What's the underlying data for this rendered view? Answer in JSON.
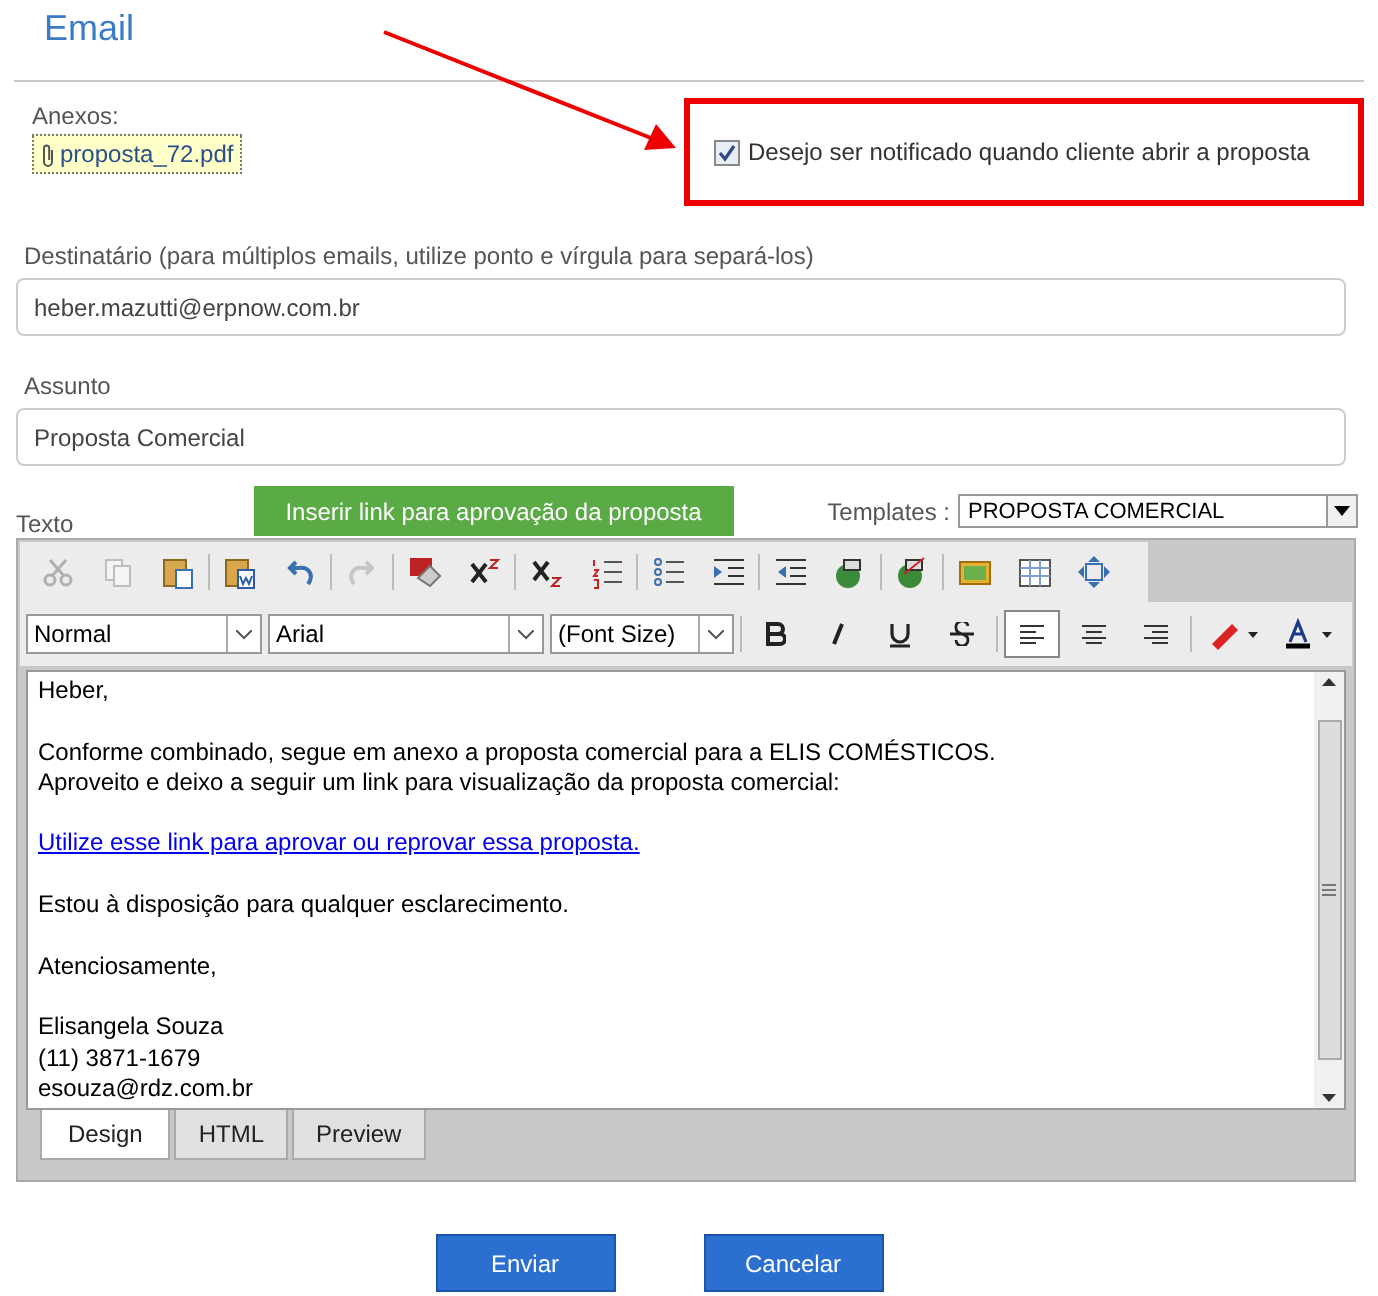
{
  "title": "Email",
  "attachments": {
    "label": "Anexos:",
    "files": [
      "proposta_72.pdf"
    ]
  },
  "notify": {
    "label": "Desejo ser notificado quando cliente abrir a proposta",
    "checked": true
  },
  "recipient": {
    "label": "Destinatário (para múltiplos emails, utilize ponto e vírgula para separá-los)",
    "value": "heber.mazutti@erpnow.com.br"
  },
  "subject": {
    "label": "Assunto",
    "value": "Proposta Comercial"
  },
  "body_label": "Texto",
  "insert_link_button": "Inserir link para aprovação da proposta",
  "templates": {
    "label": "Templates :",
    "value": "PROPOSTA COMERCIAL"
  },
  "toolbar": [
    {
      "disabled": true
    },
    {
      "disabled": true
    },
    {
      "disabled": false
    },
    {
      "disabled": false
    },
    {
      "disabled": false
    },
    {
      "disabled": true
    },
    {
      "disabled": false
    },
    {
      "disabled": false
    },
    {
      "disabled": false
    },
    {
      "disabled": false
    },
    {
      "disabled": false
    },
    {
      "disabled": false
    },
    {
      "disabled": false
    },
    {
      "disabled": false
    },
    {
      "disabled": false
    },
    {
      "disabled": false
    },
    {
      "disabled": false
    },
    {
      "disabled": false
    }
  ],
  "format_bar": {
    "style": "Normal",
    "font": "Arial",
    "size": "(Font Size)",
    "align_left_selected": true
  },
  "body": [
    {
      "kind": "text",
      "text": "Heber,"
    },
    {
      "kind": "blank"
    },
    {
      "kind": "text",
      "text": "Conforme combinado, segue em anexo a proposta comercial para a ELIS COMÉSTICOS."
    },
    {
      "kind": "text",
      "text": "Aproveito e deixo a seguir um link para visualização da proposta comercial:"
    },
    {
      "kind": "blank"
    },
    {
      "kind": "link",
      "text": "Utilize esse link para aprovar ou reprovar essa proposta."
    },
    {
      "kind": "blank"
    },
    {
      "kind": "text",
      "text": "Estou à disposição para qualquer esclarecimento."
    },
    {
      "kind": "blank"
    },
    {
      "kind": "text",
      "text": "Atenciosamente,"
    },
    {
      "kind": "blank"
    },
    {
      "kind": "text",
      "text": "Elisangela Souza"
    },
    {
      "kind": "text",
      "text": "(11) 3871-1679"
    },
    {
      "kind": "text",
      "text": "esouza@rdz.com.br"
    }
  ],
  "editor_tabs": [
    {
      "label": "Design",
      "selected": true
    },
    {
      "label": "HTML",
      "selected": false
    },
    {
      "label": "Preview",
      "selected": false
    }
  ],
  "buttons": [
    "Enviar",
    "Cancelar"
  ]
}
